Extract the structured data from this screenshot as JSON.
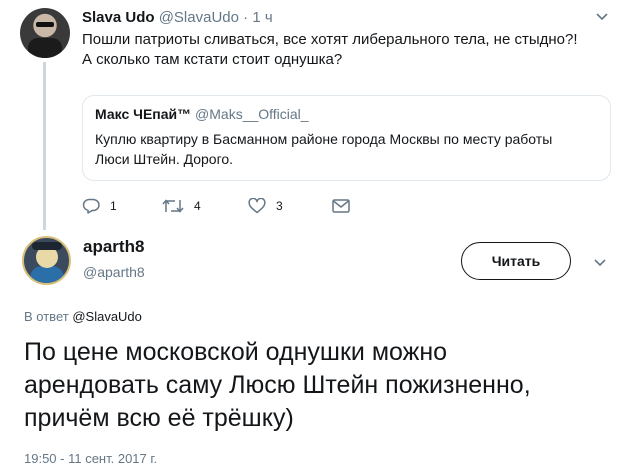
{
  "tweet": {
    "author_name": "Slava Udo",
    "author_handle": "@SlavaUdo",
    "separator": "·",
    "time": "1 ч",
    "text_line1": "Пошли патриоты сливаться, все хотят либерального тела, не стыдно?!",
    "text_line2": "А сколько там кстати стоит однушка?",
    "quote": {
      "author_name": "Макс ЧЕпай™",
      "author_handle": "@Maks__Official_",
      "text_line1": "Куплю квартиру в Басманном районе города Москвы по месту работы",
      "text_line2": "Люси Штейн. Дорого."
    },
    "actions": {
      "replies": "1",
      "retweets": "4",
      "likes": "3"
    },
    "icons": {
      "menu": "chevron-down-icon",
      "reply": "reply-icon",
      "retweet": "retweet-icon",
      "like": "heart-icon",
      "message": "envelope-icon"
    }
  },
  "reply": {
    "author_name": "aparth8",
    "author_handle": "@aparth8",
    "follow_label": "Читать",
    "reply_prefix": "В ответ",
    "reply_mention": "@SlavaUdo",
    "text_line1": "По цене московской однушки можно",
    "text_line2": "арендовать саму Люсю Штейн пожизненно,",
    "text_line3": "причём всю её трёшку)",
    "timestamp": "19:50 - 11 сент. 2017 г."
  },
  "colors": {
    "text": "#14171a",
    "muted": "#657786",
    "border": "#e1e8ed",
    "thread": "#ccd6dd"
  }
}
